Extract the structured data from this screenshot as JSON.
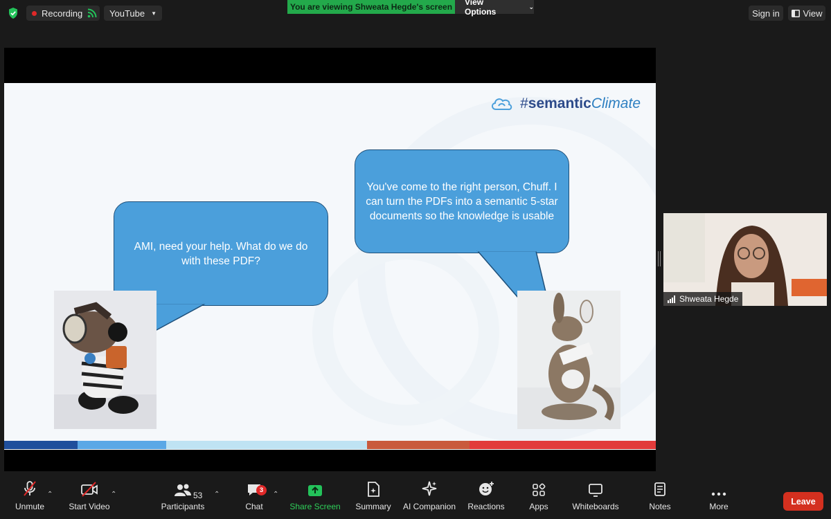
{
  "topbar": {
    "recording_label": "Recording",
    "live_dropdown_label": "YouTube",
    "viewing_banner": "You are viewing Shweata Hegde's screen",
    "view_options_label": "View Options",
    "sign_in_label": "Sign in",
    "view_label": "View"
  },
  "slide": {
    "brand": {
      "hash": "#",
      "bold": "semantic",
      "italic": "Climate"
    },
    "bubble_left": "AMI, need your help. What do we do with these PDF?",
    "bubble_right": "You've come to the right person, Chuff. I can turn the PDFs into a semantic 5-star documents so the knowledge is usable",
    "stripe_colors": [
      "#1f4f9c",
      "#5aa8e6",
      "#bfe3f3",
      "#c95a3d",
      "#e23b3b"
    ]
  },
  "participant_video": {
    "name": "Shweata Hegde"
  },
  "toolbar": {
    "unmute": "Unmute",
    "start_video": "Start Video",
    "participants": "Participants",
    "participants_count": "53",
    "chat": "Chat",
    "chat_badge": "3",
    "share_screen": "Share Screen",
    "summary": "Summary",
    "ai_companion": "AI Companion",
    "reactions": "Reactions",
    "apps": "Apps",
    "whiteboards": "Whiteboards",
    "notes": "Notes",
    "more": "More",
    "leave": "Leave"
  },
  "colors": {
    "accent_green": "#23a94b",
    "leave_red": "#d4301f",
    "bubble_blue": "#4b9fdb"
  }
}
